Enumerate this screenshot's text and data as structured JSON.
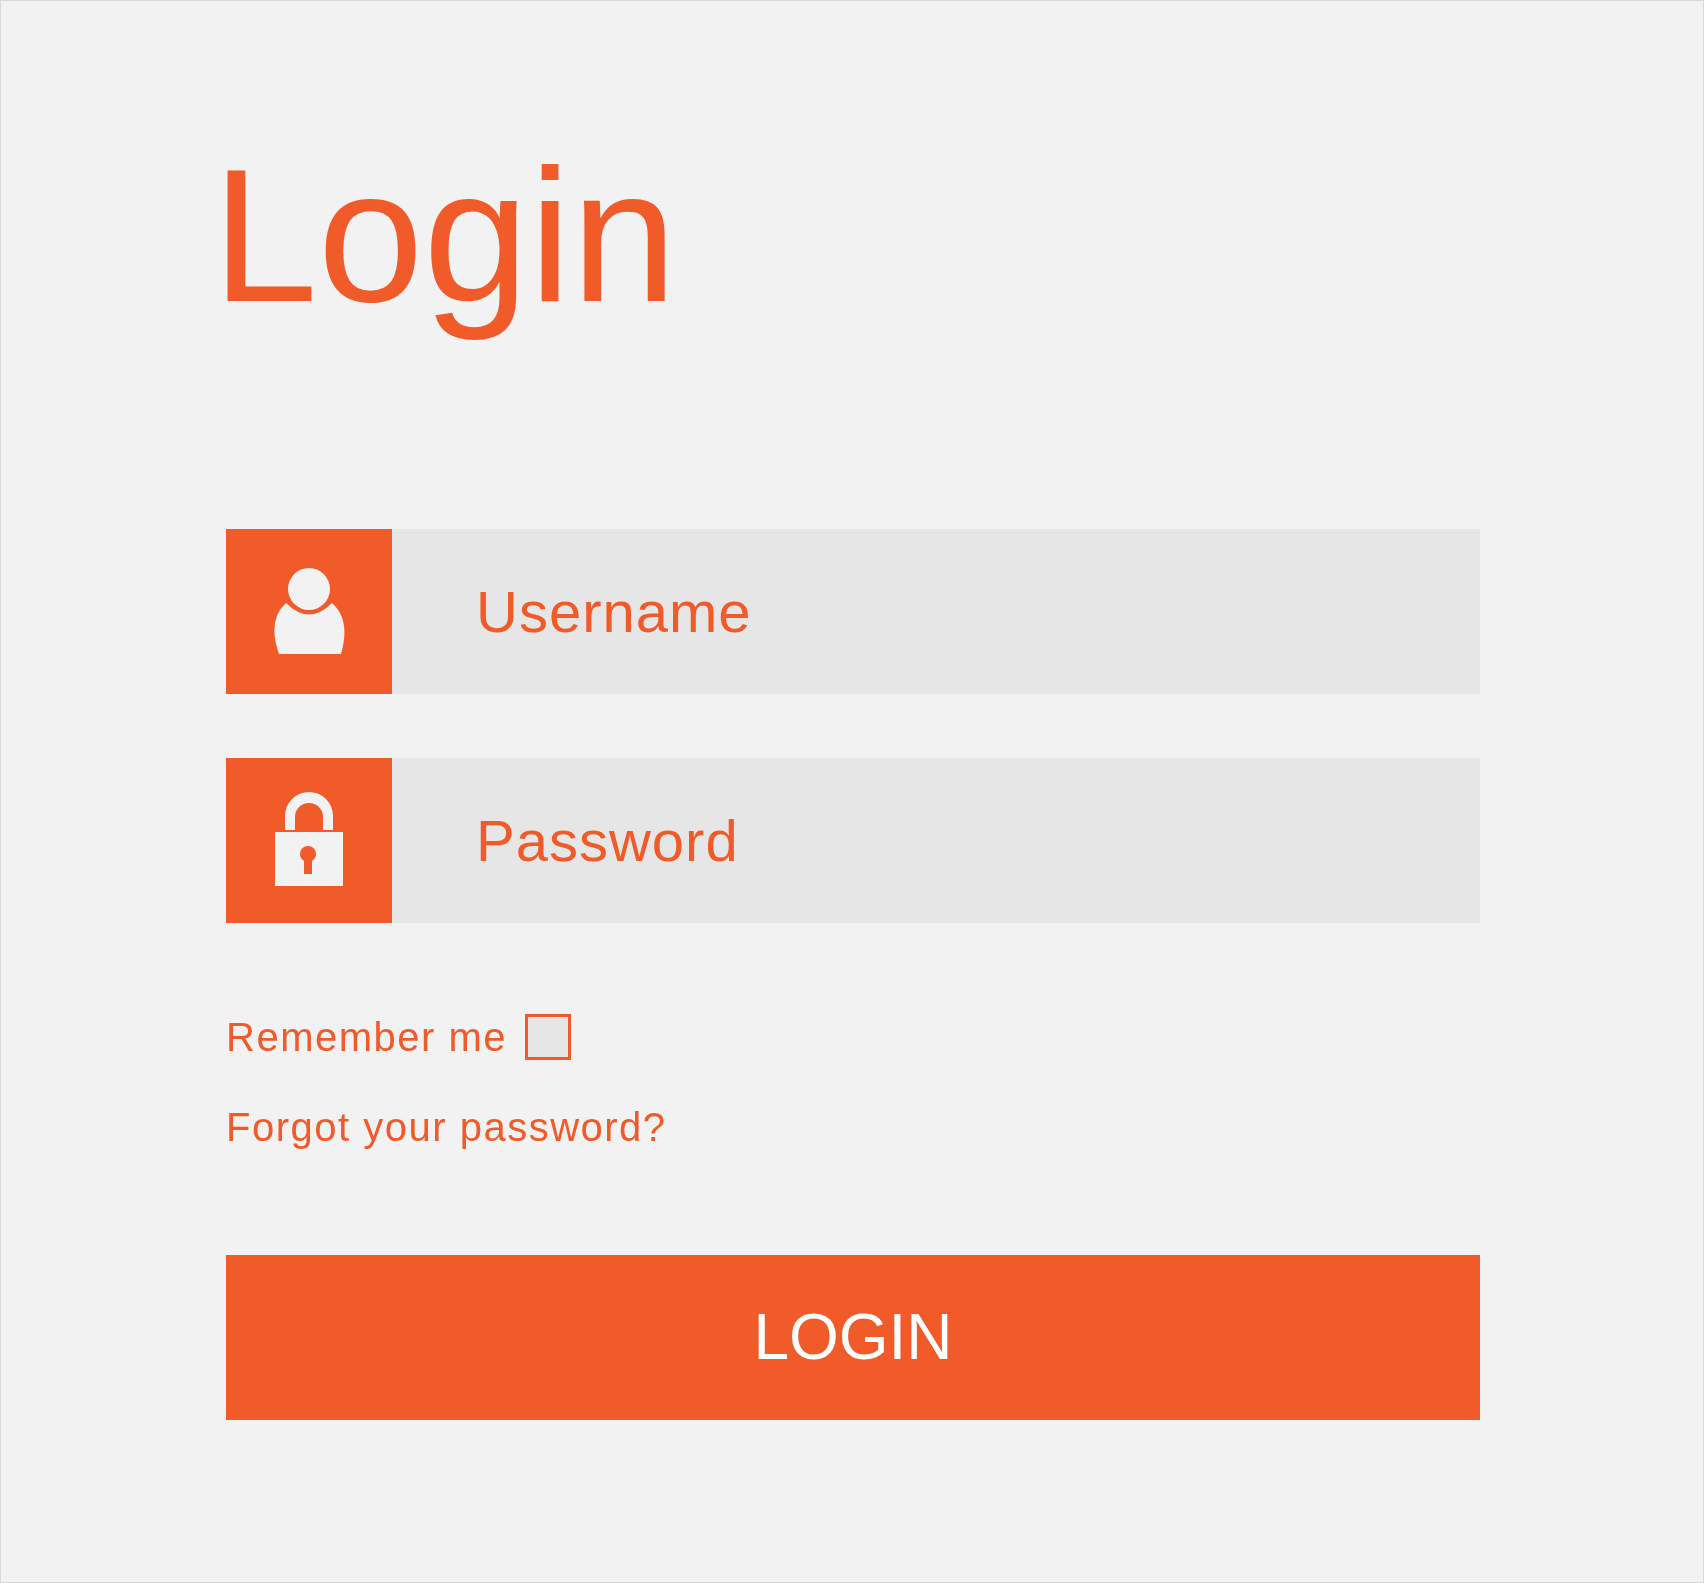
{
  "title": "Login",
  "fields": [
    {
      "kind": "user",
      "placeholder": "Username"
    },
    {
      "kind": "lock",
      "placeholder": "Password"
    }
  ],
  "remember": {
    "label": "Remember me",
    "checked": false
  },
  "forgot_link": "Forgot your password?",
  "login_button": "LOGIN"
}
